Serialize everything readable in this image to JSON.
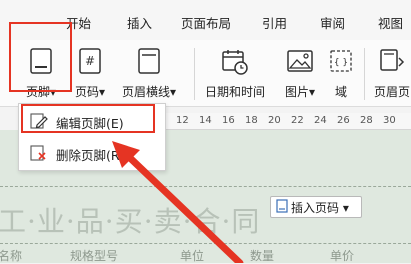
{
  "tabs": [
    "开始",
    "插入",
    "页面布局",
    "引用",
    "审阅",
    "视图"
  ],
  "ribbon": {
    "footer_label": "页脚",
    "page_number_label": "页码",
    "header_line_label": "页眉横线",
    "datetime_label": "日期和时间",
    "picture_label": "图片",
    "field_label": "域",
    "header_footer_label": "页眉页"
  },
  "ruler": {
    "ticks": [
      "12",
      "14",
      "16",
      "18",
      "20",
      "22",
      "24",
      "26",
      "28",
      "30"
    ]
  },
  "menu": {
    "edit_footer": "编辑页脚(E)",
    "delete_footer": "删除页脚(R)"
  },
  "document": {
    "title_text": "工·业·品·买·卖·合·同",
    "insert_page_number": "插入页码",
    "table_headers": [
      "名称",
      "规格型号",
      "单位",
      "数量",
      "单价"
    ]
  },
  "colors": {
    "highlight_red": "#e53423",
    "document_bg": "#dfe8df"
  }
}
